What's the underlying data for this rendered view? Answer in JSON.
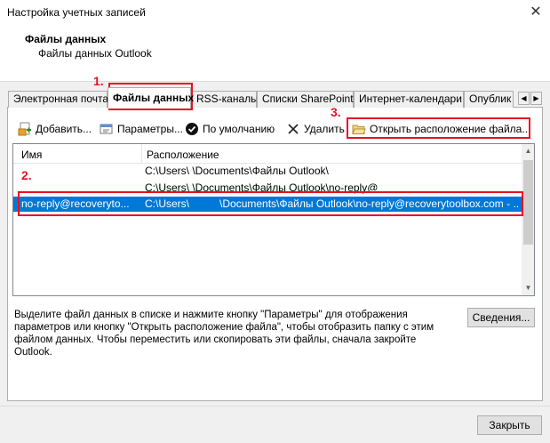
{
  "window": {
    "title": "Настройка учетных записей",
    "close_glyph": "✕"
  },
  "header": {
    "title": "Файлы данных",
    "subtitle": "Файлы данных Outlook"
  },
  "tabs": [
    {
      "label": "Электронная почта"
    },
    {
      "label": "Файлы данных"
    },
    {
      "label": "RSS-каналы"
    },
    {
      "label": "Списки SharePoint"
    },
    {
      "label": "Интернет-календари"
    },
    {
      "label": "Опублик"
    }
  ],
  "toolbar": {
    "add_label": "Добавить...",
    "params_label": "Параметры...",
    "default_label": "По умолчанию",
    "delete_label": "Удалить",
    "open_location_label": "Открыть расположение файла..."
  },
  "list": {
    "col_name": "Имя",
    "col_location": "Расположение",
    "rows": [
      {
        "name": "",
        "location": "C:\\Users\\         \\Documents\\Файлы Outlook\\"
      },
      {
        "name": "",
        "location": "C:\\Users\\         \\Documents\\Файлы Outlook\\no-reply@"
      },
      {
        "name": "no-reply@recoveryto...",
        "location_prefix": "C:\\Users\\",
        "location_suffix": "\\Documents\\Файлы Outlook\\no-reply@recoverytoolbox.com - ..."
      }
    ]
  },
  "description": "Выделите файл данных в списке и нажмите кнопку \"Параметры\" для отображения параметров или кнопку \"Открыть расположение файла\", чтобы отобразить папку с этим файлом данных. Чтобы переместить или скопировать эти файлы, сначала закройте Outlook.",
  "buttons": {
    "details_label": "Сведения...",
    "close_label": "Закрыть"
  },
  "annotations": {
    "step1": "1.",
    "step2": "2.",
    "step3": "3.",
    "color": "#e81123"
  },
  "colors": {
    "selection": "#0078d7",
    "background": "#f0f0f0"
  }
}
